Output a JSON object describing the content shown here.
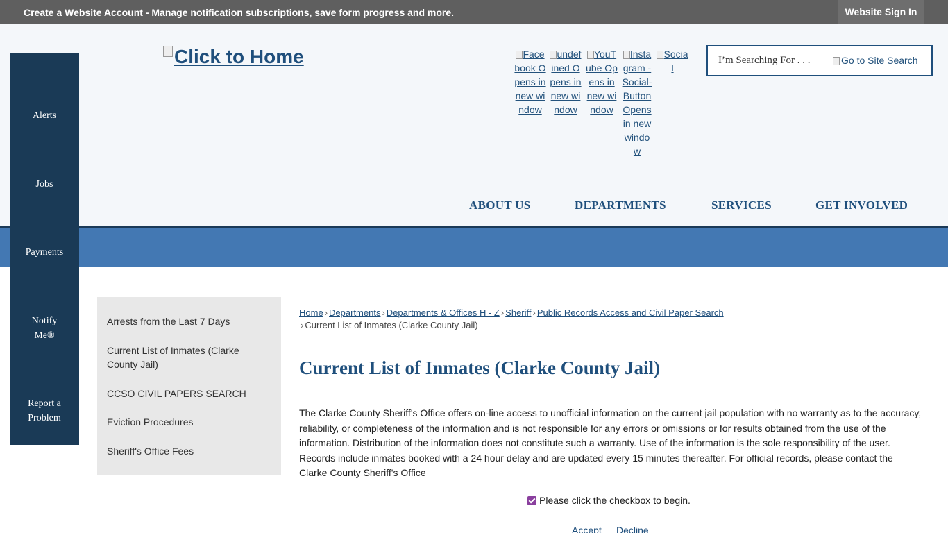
{
  "topbar": {
    "create_account": "Create a Website Account",
    "create_rest": " - Manage notification subscriptions, save form progress and more.",
    "sign_in": "Website Sign In"
  },
  "quick_links": [
    "Alerts",
    "Jobs",
    "Payments",
    "Notify Me®",
    "Report a Problem"
  ],
  "header": {
    "home_logo_alt": "Click to Home",
    "social": [
      {
        "label": "Facebook Opens in new window",
        "icon": "facebook-icon"
      },
      {
        "label": "undefined Opens in new window",
        "icon": "undefined-icon"
      },
      {
        "label": "YouTube Opens in new window",
        "icon": "youtube-icon"
      },
      {
        "label": "Instagram - Social-Button Opens in new window",
        "icon": "instagram-icon"
      },
      {
        "label": "Social",
        "icon": "social-icon"
      }
    ],
    "search_placeholder": "I’m Searching For . . .",
    "search_button_alt": "Go to Site Search"
  },
  "main_nav": [
    "ABOUT US",
    "DEPARTMENTS",
    "SERVICES",
    "GET INVOLVED"
  ],
  "subnav": [
    "Arrests from the Last 7 Days",
    "Current List of Inmates (Clarke County Jail)",
    "CCSO CIVIL PAPERS SEARCH",
    "Eviction Procedures",
    "Sheriff's Office Fees"
  ],
  "breadcrumb": {
    "links": [
      "Home",
      "Departments",
      "Departments & Offices H - Z",
      "Sheriff",
      "Public Records Access and Civil Paper Search"
    ],
    "current": "Current List of Inmates (Clarke County Jail)"
  },
  "page": {
    "title": "Current List of Inmates (Clarke County Jail)",
    "body": "The Clarke County Sheriff's Office offers on-line access to unofficial information on the current jail population with no warranty as to the accuracy, reliability, or completeness of the information and is not responsible for any errors or omissions or for results obtained from the use of the information. Distribution of the information does not constitute such a warranty. Use of the information is the sole responsibility of the user. Records include inmates booked with a 24 hour delay and are updated every 15 minutes thereafter. For official records, please contact the Clarke County Sheriff's Office",
    "checkbox_label": "Please click the checkbox to begin.",
    "checkbox_checked": true,
    "accept": "Accept",
    "decline": "Decline"
  },
  "colors": {
    "topbar": "#5f5f5f",
    "quicklinks_bg": "#1a3a56",
    "banner": "#4378b3",
    "link": "#1f4f7c",
    "subnav_bg": "#e8e8e8"
  }
}
